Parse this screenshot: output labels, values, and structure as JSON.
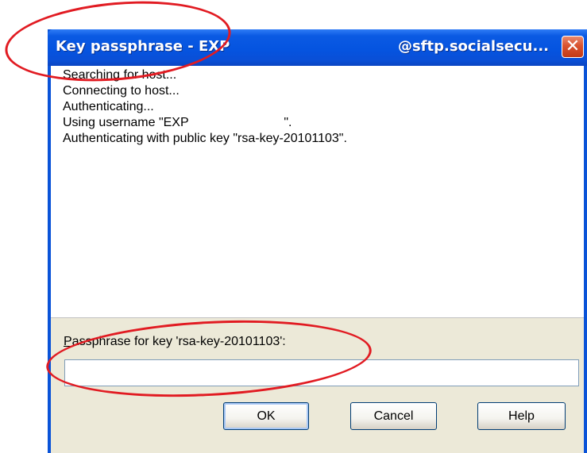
{
  "window": {
    "title_left": "Key passphrase - EXP",
    "title_right": "@sftp.socialsecu...",
    "close_glyph": "✕"
  },
  "log": {
    "lines": [
      "Searching for host...",
      "Connecting to host...",
      "Authenticating...",
      "Using username \"EXP                           \".",
      "Authenticating with public key \"rsa-key-20101103\"."
    ]
  },
  "passphrase": {
    "label_accel": "P",
    "label_rest": "assphrase for key 'rsa-key-20101103':",
    "value": ""
  },
  "buttons": {
    "ok": "OK",
    "cancel": "Cancel",
    "help": "Help"
  },
  "colors": {
    "titlebar": "#0554e0",
    "frame": "#0a53d8",
    "dialog_bg": "#ece9d8",
    "annotation": "#e11b22"
  },
  "icons": [
    "close-icon"
  ]
}
